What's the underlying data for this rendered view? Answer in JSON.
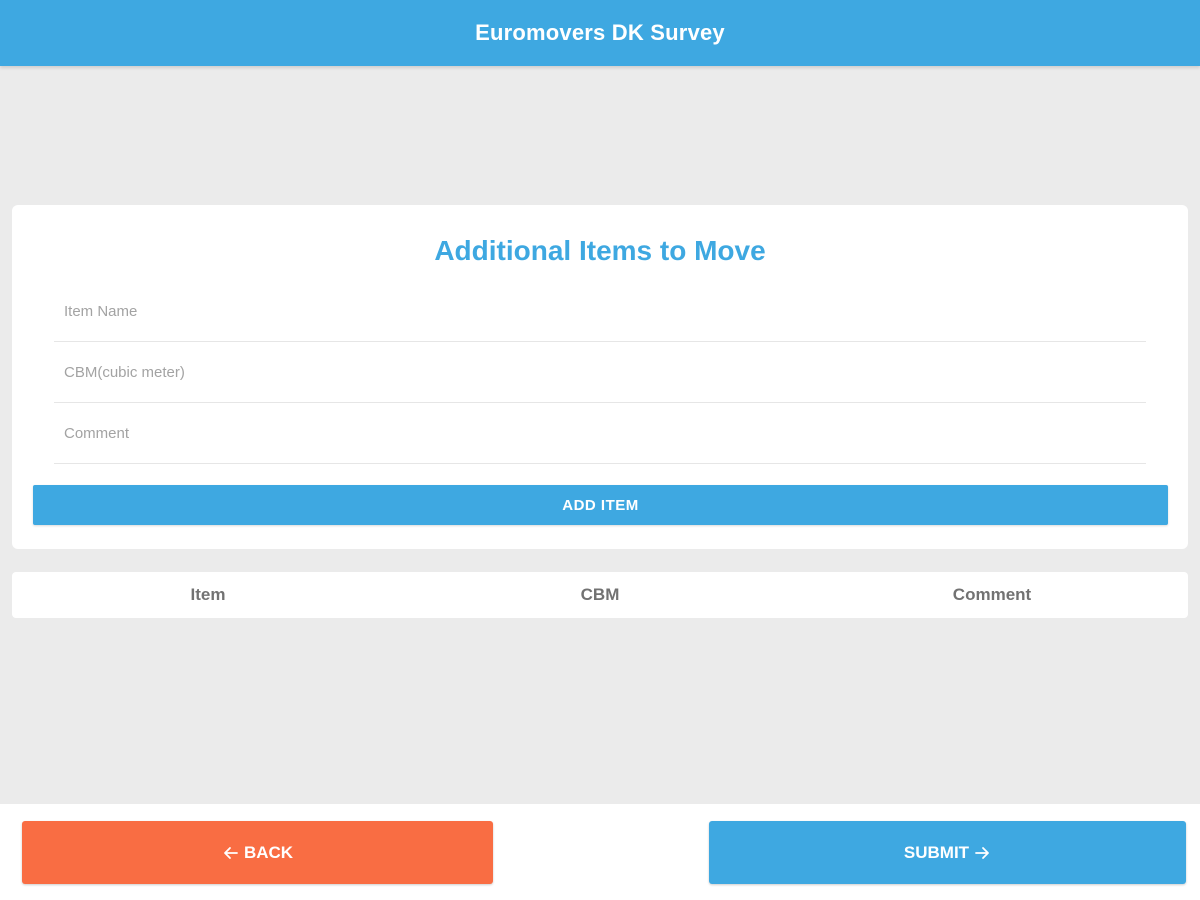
{
  "header": {
    "title": "Euromovers DK Survey"
  },
  "form": {
    "title": "Additional Items to Move",
    "item_name_placeholder": "Item Name",
    "cbm_placeholder": "CBM(cubic meter)",
    "comment_placeholder": "Comment",
    "add_button_label": "ADD ITEM"
  },
  "table": {
    "columns": [
      "Item",
      "CBM",
      "Comment"
    ]
  },
  "footer": {
    "back_label": "BACK",
    "submit_label": "SUBMIT"
  },
  "icons": {
    "back": "arrow-left-icon",
    "submit": "arrow-right-icon"
  },
  "colors": {
    "primary": "#3ea8e1",
    "back": "#f96d43",
    "background": "#ebebeb"
  }
}
